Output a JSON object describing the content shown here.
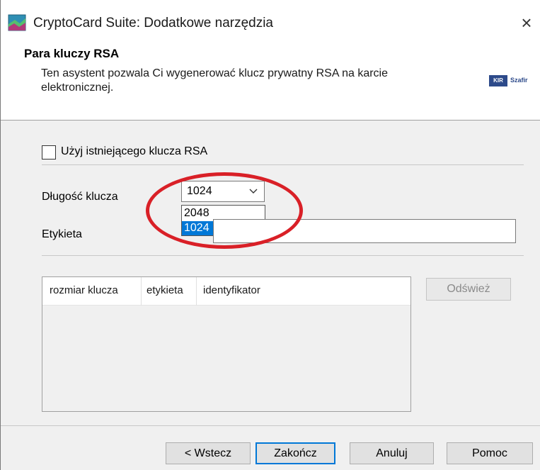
{
  "window": {
    "title": "CryptoCard Suite: Dodatkowe narzędzia",
    "close_glyph": "×"
  },
  "header": {
    "title": "Para kluczy RSA",
    "description": "Ten asystent pozwala Ci wygenerować klucz prywatny RSA na karcie elektronicznej.",
    "logo_box": "KIR",
    "logo_text": "Szafir"
  },
  "form": {
    "use_existing_label": "Użyj istniejącego klucza RSA",
    "use_existing_checked": false,
    "key_length_label": "Długość klucza",
    "key_length_value": "1024",
    "key_length_options": [
      "2048",
      "1024"
    ],
    "key_length_highlighted": "1024",
    "label_field_label": "Etykieta",
    "label_field_value": ""
  },
  "table": {
    "columns": [
      "rozmiar klucza",
      "etykieta",
      "identyfikator"
    ],
    "rows": []
  },
  "buttons": {
    "refresh": "Odśwież",
    "back": "< Wstecz",
    "finish": "Zakończ",
    "cancel": "Anuluj",
    "help": "Pomoc"
  },
  "colors": {
    "highlight": "#0078d7",
    "annotation_circle": "#d92027",
    "logo": "#2d4a8a"
  },
  "icons": {
    "app": "cryptocard-app-icon",
    "dropdown": "chevron-down-icon",
    "close": "close-icon"
  }
}
